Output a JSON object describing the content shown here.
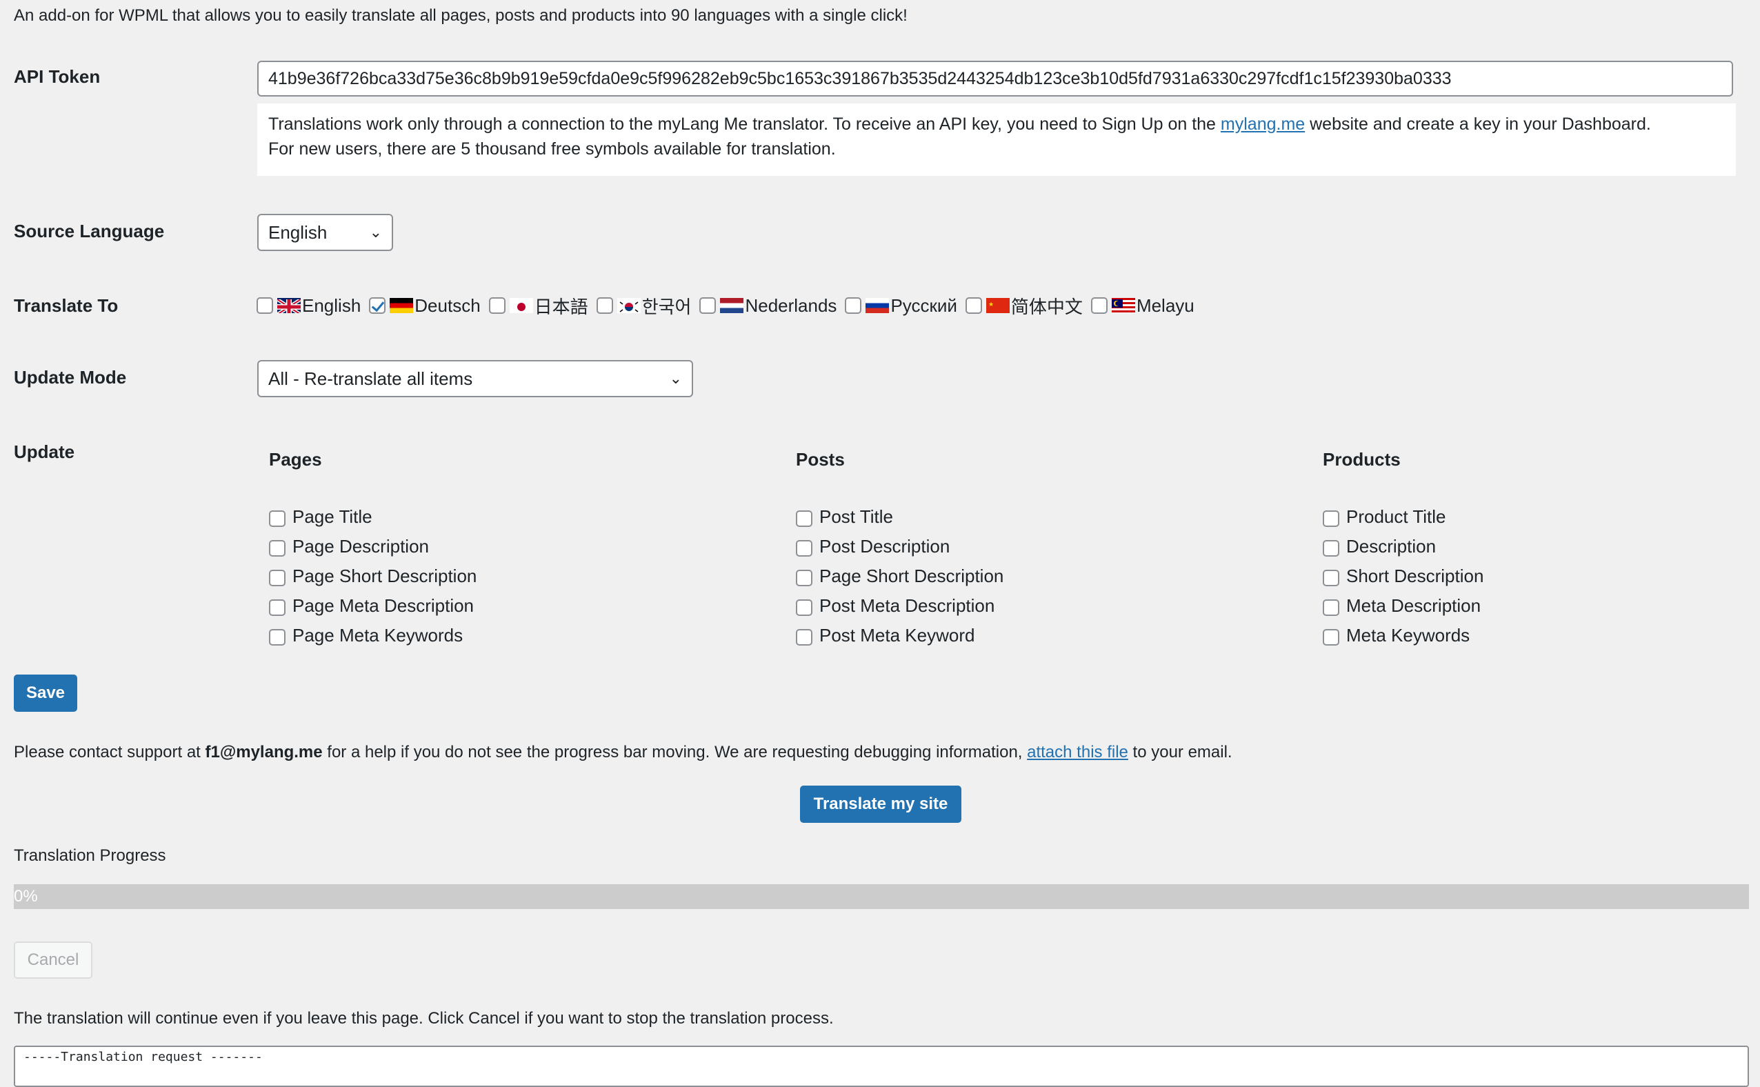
{
  "intro": "An add-on for WPML that allows you to easily translate all pages, posts and products into 90 languages with a single click!",
  "api_token": {
    "label": "API Token",
    "value": "41b9e36f726bca33d75e36c8b9b919e59cfda0e9c5f996282eb9c5bc1653c391867b3535d2443254db123ce3b10d5fd7931a6330c297fcdf1c15f23930ba0333",
    "note_part1": "Translations work only through a connection to the myLang Me translator. To receive an API key, you need to Sign Up on the ",
    "note_link": "mylang.me",
    "note_part2": " website and create a key in your Dashboard.",
    "note_line2": "For new users, there are 5 thousand free symbols available for translation."
  },
  "source_language": {
    "label": "Source Language",
    "value": "English"
  },
  "translate_to": {
    "label": "Translate To",
    "languages": [
      {
        "name": "English",
        "checked": false,
        "flag": "uk-flag-icon"
      },
      {
        "name": "Deutsch",
        "checked": true,
        "flag": "germany-flag-icon"
      },
      {
        "name": "日本語",
        "checked": false,
        "flag": "japan-flag-icon"
      },
      {
        "name": "한국어",
        "checked": false,
        "flag": "korea-flag-icon"
      },
      {
        "name": "Nederlands",
        "checked": false,
        "flag": "netherlands-flag-icon"
      },
      {
        "name": "Русский",
        "checked": false,
        "flag": "russia-flag-icon"
      },
      {
        "name": "简体中文",
        "checked": false,
        "flag": "china-flag-icon"
      },
      {
        "name": "Melayu",
        "checked": false,
        "flag": "malaysia-flag-icon"
      }
    ]
  },
  "update_mode": {
    "label": "Update Mode",
    "value": "All - Re-translate all items"
  },
  "update": {
    "label": "Update",
    "columns": [
      {
        "title": "Pages",
        "items": [
          "Page Title",
          "Page Description",
          "Page Short Description",
          "Page Meta Description",
          "Page Meta Keywords"
        ]
      },
      {
        "title": "Posts",
        "items": [
          "Post Title",
          "Post Description",
          "Page Short Description",
          "Post Meta Description",
          "Post Meta Keyword"
        ]
      },
      {
        "title": "Products",
        "items": [
          "Product Title",
          "Description",
          "Short Description",
          "Meta Description",
          "Meta Keywords"
        ]
      }
    ]
  },
  "save_label": "Save",
  "contact": {
    "part1": "Please contact support at ",
    "email": "f1@mylang.me",
    "part2": " for a help if you do not see the progress bar moving. We are requesting debugging information, ",
    "link": "attach this file",
    "part3": " to your email."
  },
  "translate_button": "Translate my site",
  "progress": {
    "label": "Translation Progress",
    "text": "0%",
    "value": 0
  },
  "cancel_label": "Cancel",
  "continue_note": "The translation will continue even if you leave this page. Click Cancel if you want to stop the translation process.",
  "log": {
    "line1": "-----Translation request -------"
  },
  "colors": {
    "primary": "#2271b1",
    "background": "#f0f0f1",
    "progress_track": "#cccccc"
  }
}
